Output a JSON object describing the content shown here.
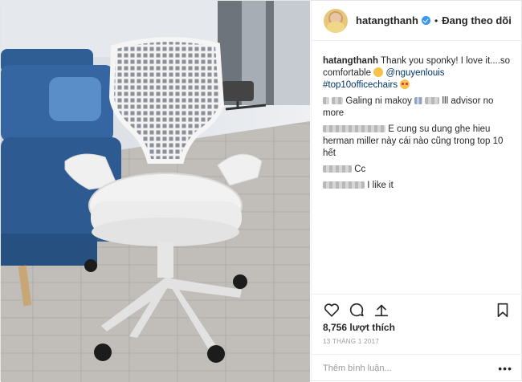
{
  "photo": {
    "alt": "White office chair"
  },
  "header": {
    "username": "hatangthanh",
    "dot": "•",
    "follow_label": "Đang theo dõi"
  },
  "comments": [
    {
      "user": "hatangthanh",
      "text": "Thank you sponky! I love it....so comfortable",
      "mention": "@nguyenlouis",
      "hashtag": "#top10officechairs"
    },
    {
      "user_hidden": true,
      "text_a": "Galing ni makoy",
      "text_b": "lll advisor no more"
    },
    {
      "user_hidden": true,
      "text": "E cung su dung ghe hieu herman miller này cái nào cũng trong top 10 hết"
    },
    {
      "user_hidden": true,
      "text": "Cc"
    },
    {
      "user_hidden": true,
      "text": "I like it"
    }
  ],
  "likes": "8,756 lượt thích",
  "date": "13 THÁNG 1 2017",
  "add_comment": {
    "placeholder": "Thêm bình luận..."
  },
  "more_label": "•••",
  "icons": [
    "heart-icon",
    "comment-icon",
    "share-icon",
    "bookmark-icon",
    "verified-badge-icon"
  ]
}
